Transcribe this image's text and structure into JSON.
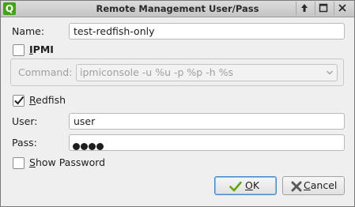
{
  "window": {
    "title": "Remote Management User/Pass",
    "app_icon_letter": "Q"
  },
  "name": {
    "label": "Name:",
    "value": "test-redfish-only"
  },
  "ipmi": {
    "checked": false,
    "label_first": "I",
    "label_rest": "PMI",
    "command_label": "Command:",
    "command_value": "ipmiconsole -u %u -p %p -h %s"
  },
  "redfish": {
    "checked": true,
    "label_first": "R",
    "label_rest": "edfish"
  },
  "user": {
    "label": "User:",
    "value": "user"
  },
  "pass": {
    "label": "Pass:",
    "masked_dots": 4
  },
  "show_password": {
    "checked": false,
    "label_first": "S",
    "label_rest": "how Password"
  },
  "buttons": {
    "ok_first": "O",
    "ok_rest": "K",
    "cancel_first": "C",
    "cancel_rest": "ancel"
  },
  "colors": {
    "ok_icon": "#5fa618",
    "cancel_icon": "#5a5a5a",
    "default_border": "#4b86c8"
  }
}
